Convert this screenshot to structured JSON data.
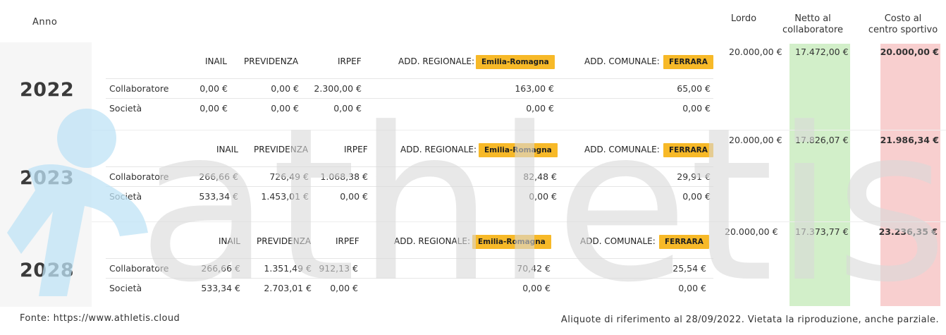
{
  "header": {
    "anno": "Anno",
    "lordo": "Lordo",
    "netto": "Netto al\ncollaboratore",
    "costo": "Costo al\ncentro sportivo"
  },
  "columns": {
    "inail": "INAIL",
    "previdenza": "PREVIDENZA",
    "irpef": "IRPEF",
    "add_regionale": "ADD. REGIONALE:",
    "add_comunale": "ADD. COMUNALE:"
  },
  "badges": {
    "regione": "Emilia-Romagna",
    "comune": "FERRARA"
  },
  "row_labels": {
    "collaboratore": "Collaboratore",
    "societa": "Società"
  },
  "years": [
    {
      "year": "2022",
      "collaboratore": {
        "inail": "0,00 €",
        "previdenza": "0,00 €",
        "irpef": "2.300,00 €",
        "add_regionale": "163,00 €",
        "add_comunale": "65,00 €"
      },
      "societa": {
        "inail": "0,00 €",
        "previdenza": "0,00 €",
        "irpef": "0,00 €",
        "add_regionale": "0,00 €",
        "add_comunale": "0,00 €"
      },
      "lordo": "20.000,00 €",
      "netto": "17.472,00 €",
      "costo": "20.000,00 €"
    },
    {
      "year": "2023",
      "collaboratore": {
        "inail": "266,66 €",
        "previdenza": "726,49 €",
        "irpef": "1.068,38 €",
        "add_regionale": "82,48 €",
        "add_comunale": "29,91 €"
      },
      "societa": {
        "inail": "533,34 €",
        "previdenza": "1.453,01 €",
        "irpef": "0,00 €",
        "add_regionale": "0,00 €",
        "add_comunale": "0,00 €"
      },
      "lordo": "20.000,00 €",
      "netto": "17.826,07 €",
      "costo": "21.986,34 €"
    },
    {
      "year": "2028",
      "collaboratore": {
        "inail": "266,66 €",
        "previdenza": "1.351,49 €",
        "irpef": "912,13 €",
        "add_regionale": "70,42 €",
        "add_comunale": "25,54 €"
      },
      "societa": {
        "inail": "533,34 €",
        "previdenza": "2.703,01 €",
        "irpef": "0,00 €",
        "add_regionale": "0,00 €",
        "add_comunale": "0,00 €"
      },
      "lordo": "20.000,00 €",
      "netto": "17.373,77 €",
      "costo": "23.236,35 €"
    }
  ],
  "footer": {
    "source": "Fonte: https://www.athletis.cloud",
    "note": "Aliquote di riferimento al 28/09/2022. Vietata la riproduzione, anche parziale."
  },
  "watermark": {
    "text": "athletis",
    "figure_color": "#bfe3f6",
    "text_color": "#e2e2e2"
  },
  "colors": {
    "badge": "#f7b928",
    "netto_bg": "#d2efc9",
    "costo_bg": "#f8cfcf"
  }
}
